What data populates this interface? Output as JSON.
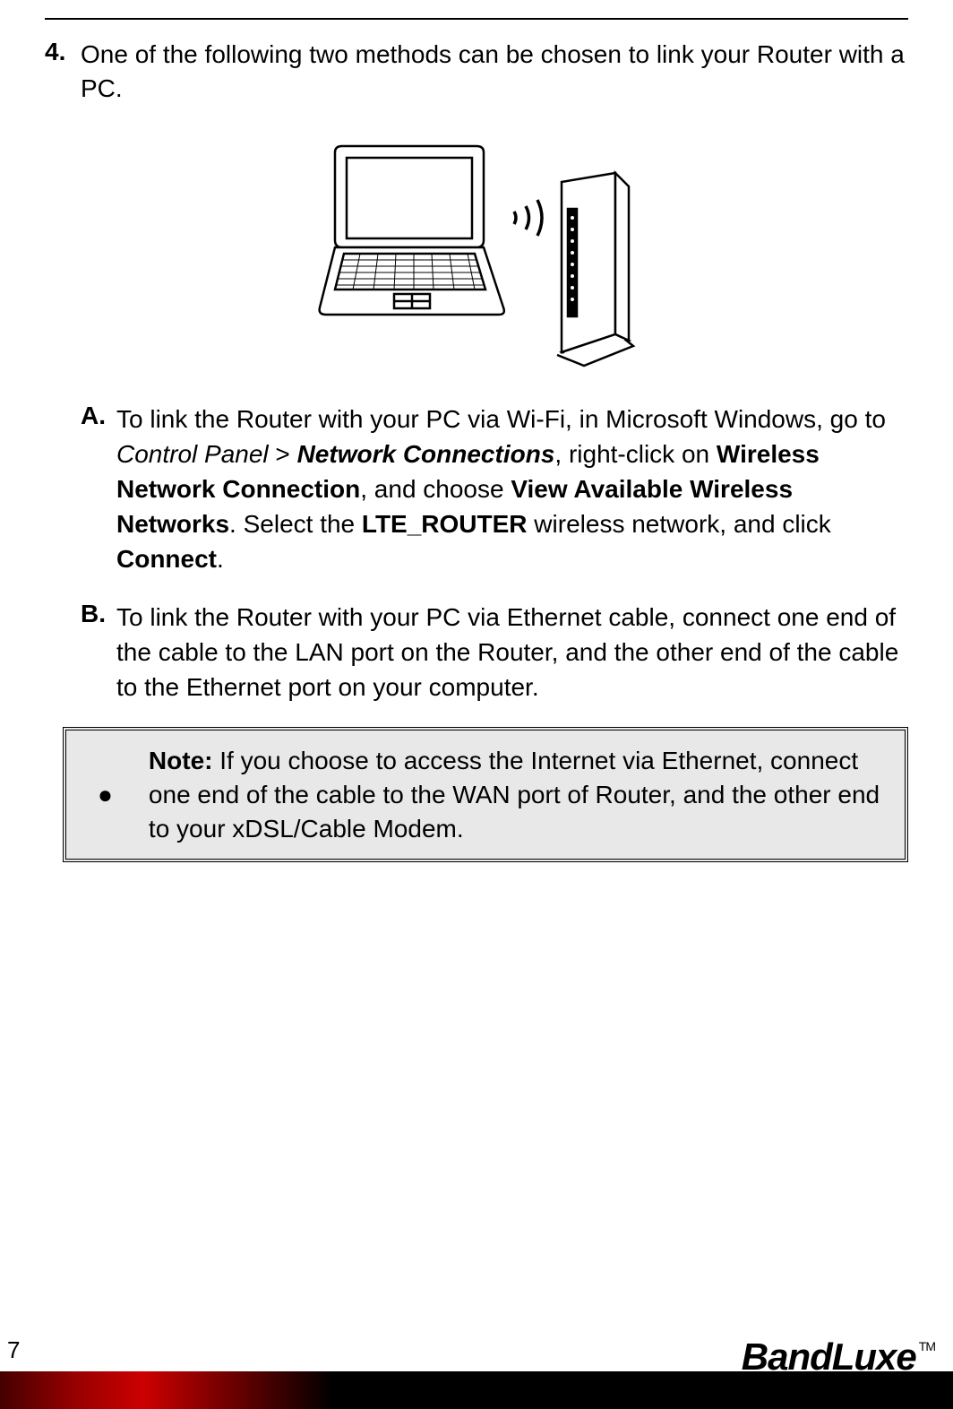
{
  "step": {
    "number": "4.",
    "text": "One of the following two methods can be chosen to link your Router with a PC."
  },
  "substeps": {
    "a": {
      "letter": "A.",
      "part1": "To link the Router with your PC via Wi-Fi, in Microsoft Windows, go to ",
      "control_panel": "Control Panel",
      "gt": " > ",
      "network_connections": "Network Connections",
      "part2": ", right-click on ",
      "wireless_connection": "Wireless Network Connection",
      "part3": ", and choose ",
      "view_networks": "View Available Wireless Networks",
      "part4": ". Select the ",
      "router_name": "LTE_ROUTER",
      "part5": " wireless network, and click ",
      "connect": "Connect",
      "part6": "."
    },
    "b": {
      "letter": "B.",
      "text": "To link the Router with your PC via Ethernet cable, connect one end of the cable to the LAN port on the Router, and the other end of the cable to the Ethernet port on your computer."
    }
  },
  "note": {
    "bullet": "●",
    "label": "Note:",
    "text": " If you choose to access the Internet via Ethernet, connect one end of the cable to the WAN port of Router, and the other end to your xDSL/Cable Modem."
  },
  "footer": {
    "page_number": "7",
    "brand": "BandLuxe",
    "tm": "TM"
  }
}
